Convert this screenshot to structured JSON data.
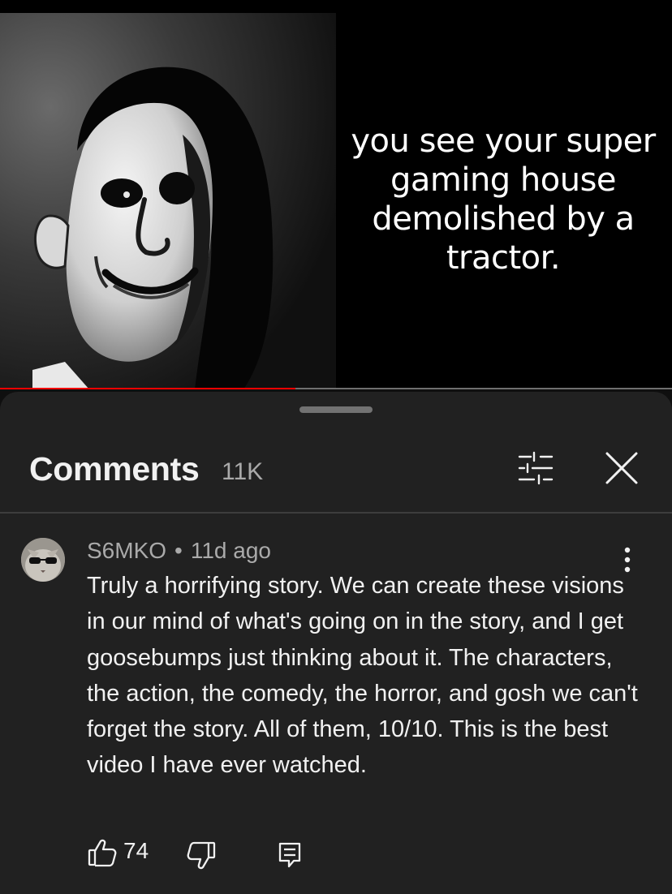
{
  "video": {
    "caption": "you see your super gaming house demolished by a tractor.",
    "progress": 0.44
  },
  "comments": {
    "title": "Comments",
    "count": "11K",
    "icons": {
      "filter": "sliders-icon",
      "close": "close-icon"
    }
  },
  "comment": {
    "author": "S6MKO",
    "separator": "•",
    "time": "11d ago",
    "text": "Truly a horrifying story. We can create these visions in our mind of what's going on in the story, and I get goosebumps just thinking about it. The characters, the action, the comedy, the horror, and gosh we can't forget the story. All of them, 10/10. This is the best video I have ever watched.",
    "likes": "74",
    "icons": {
      "more": "more-vertical-icon",
      "like": "thumbs-up-icon",
      "dislike": "thumbs-down-icon",
      "reply": "reply-icon"
    }
  },
  "colors": {
    "accent": "#ff0000",
    "sheet": "#212121",
    "secondary_text": "#aaaaaa"
  }
}
